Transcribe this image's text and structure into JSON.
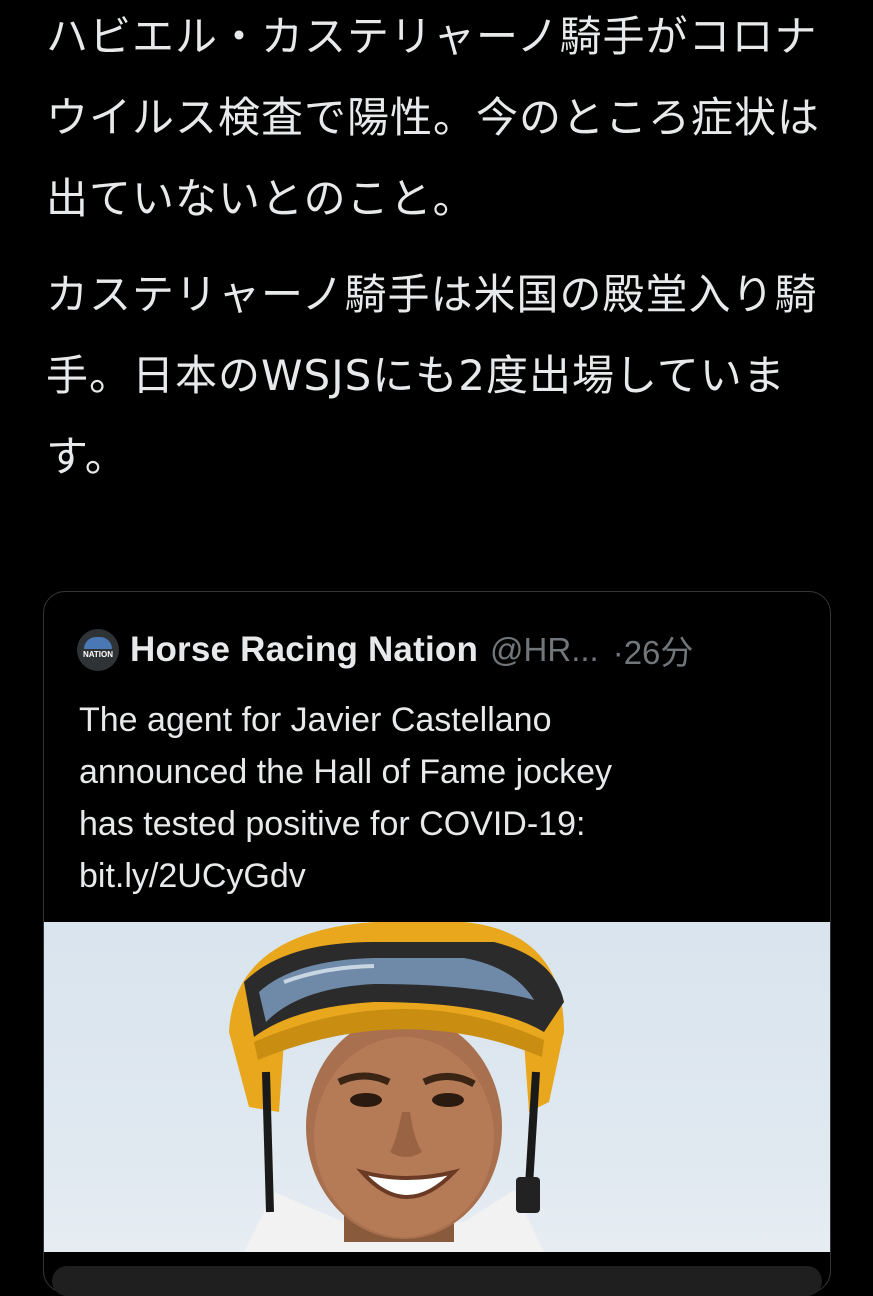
{
  "tweet": {
    "paragraph_1": "ハビエル・カステリャーノ騎手がコロナウイルス検査で陽性。今のところ症状は出ていないとのこと。",
    "paragraph_2": "カステリャーノ騎手は米国の殿堂入り騎手。日本のWSJSにも2度出場しています。"
  },
  "quoted_tweet": {
    "source_name": "Horse Racing Nation",
    "handle": "@HR...",
    "time": "·26分",
    "avatar_logo": "HORSE RACING NATION",
    "text_lines": [
      "The agent for Javier Castellano",
      "announced the Hall of Fame jockey",
      "has tested positive for COVID-19:",
      "bit.ly/2UCyGdv"
    ],
    "image": "jockey-photo"
  },
  "colors": {
    "background": "#000000",
    "text_primary": "#e7e9ea",
    "text_secondary": "#71767b",
    "card_border": "#333639",
    "helmet_yellow": "#e8a71c"
  }
}
